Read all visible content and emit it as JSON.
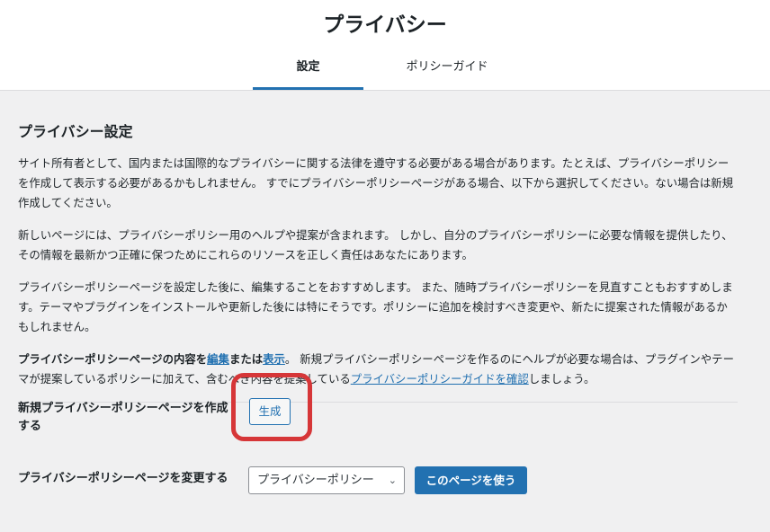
{
  "header": {
    "title": "プライバシー",
    "tabs": [
      "設定",
      "ポリシーガイド"
    ]
  },
  "section": {
    "title": "プライバシー設定",
    "p1": "サイト所有者として、国内または国際的なプライバシーに関する法律を遵守する必要がある場合があります。たとえば、プライバシーポリシーを作成して表示する必要があるかもしれません。 すでにプライバシーポリシーページがある場合、以下から選択してください。ない場合は新規作成してください。",
    "p2": "新しいページには、プライバシーポリシー用のヘルプや提案が含まれます。 しかし、自分のプライバシーポリシーに必要な情報を提供したり、その情報を最新かつ正確に保つためにこれらのリソースを正しく責任はあなたにあります。",
    "p3": "プライバシーポリシーページを設定した後に、編集することをおすすめします。 また、随時プライバシーポリシーを見直すこともおすすめします。テーマやプラグインをインストールや更新した後には特にそうです。ポリシーに追加を検討すべき変更や、新たに提案された情報があるかもしれません。",
    "p4_pre": "プライバシーポリシーページの内容を",
    "p4_edit": "編集",
    "p4_mid": "または",
    "p4_view": "表示",
    "p4_after": "。 新規プライバシーポリシーページを作るのにヘルプが必要な場合は、プラグインやテーマが提案しているポリシーに加えて、含むべき内容を提案している",
    "p4_guide_link": "プライバシーポリシーガイドを確認",
    "p4_end": "しましょう。"
  },
  "create_row": {
    "label": "新規プライバシーポリシーページを作成する",
    "button": "生成"
  },
  "change_row": {
    "label": "プライバシーポリシーページを変更する",
    "select_value": "プライバシーポリシー",
    "button": "このページを使う"
  },
  "colors": {
    "accent": "#2271b1",
    "highlight": "#d63638"
  }
}
